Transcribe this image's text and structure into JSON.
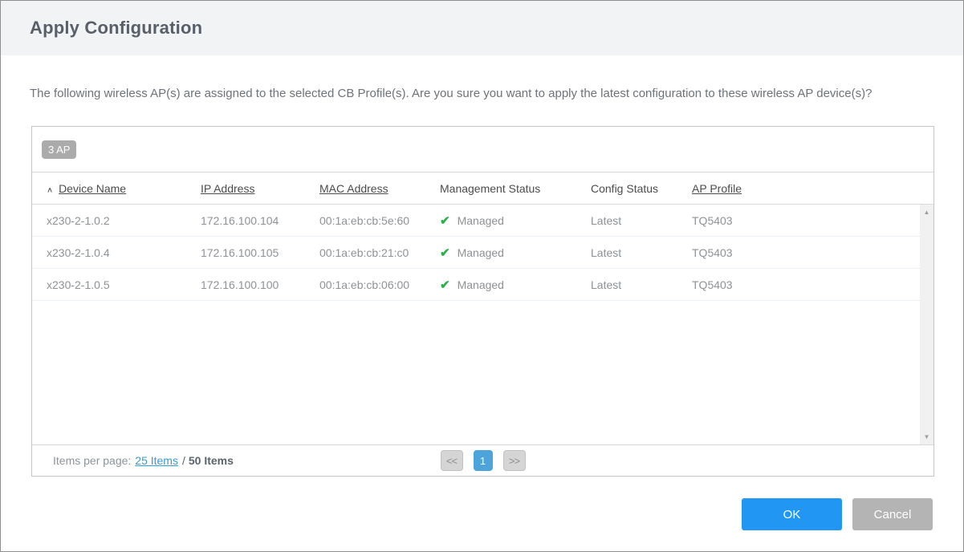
{
  "dialog": {
    "title": "Apply Configuration",
    "message": "The following wireless AP(s) are assigned to the selected CB Profile(s). Are you sure you want to apply the latest configuration to these wireless AP device(s)?"
  },
  "table": {
    "badge": "3 AP",
    "columns": [
      {
        "label": "Device Name",
        "sortable": true,
        "sorted": "asc"
      },
      {
        "label": "IP Address",
        "sortable": true
      },
      {
        "label": "MAC Address",
        "sortable": true
      },
      {
        "label": "Management Status",
        "sortable": false
      },
      {
        "label": "Config Status",
        "sortable": false
      },
      {
        "label": "AP Profile",
        "sortable": true
      }
    ],
    "rows": [
      {
        "device_name": "x230-2-1.0.2",
        "ip_address": "172.16.100.104",
        "mac_address": "00:1a:eb:cb:5e:60",
        "management_status": "Managed",
        "config_status": "Latest",
        "ap_profile": "TQ5403"
      },
      {
        "device_name": "x230-2-1.0.4",
        "ip_address": "172.16.100.105",
        "mac_address": "00:1a:eb:cb:21:c0",
        "management_status": "Managed",
        "config_status": "Latest",
        "ap_profile": "TQ5403"
      },
      {
        "device_name": "x230-2-1.0.5",
        "ip_address": "172.16.100.100",
        "mac_address": "00:1a:eb:cb:06:00",
        "management_status": "Managed",
        "config_status": "Latest",
        "ap_profile": "TQ5403"
      }
    ]
  },
  "icons": {
    "sort_asc": "∧",
    "check": "✔",
    "scroll_up": "▲",
    "scroll_down": "▼"
  },
  "pagination": {
    "items_per_page_label": "Items per page:",
    "page_size_link": "25 Items",
    "separator": "/",
    "total_label": "50 Items",
    "prev_label": "<<",
    "current_page": "1",
    "next_label": ">>"
  },
  "actions": {
    "ok_label": "OK",
    "cancel_label": "Cancel"
  },
  "colors": {
    "accent_blue": "#2196f3",
    "pager_active_blue": "#4da4da",
    "link_blue": "#3a9ad2",
    "status_green": "#2daf4d",
    "badge_gray": "#ababab",
    "cancel_gray": "#b4b4b4",
    "header_bg": "#f2f3f5"
  }
}
